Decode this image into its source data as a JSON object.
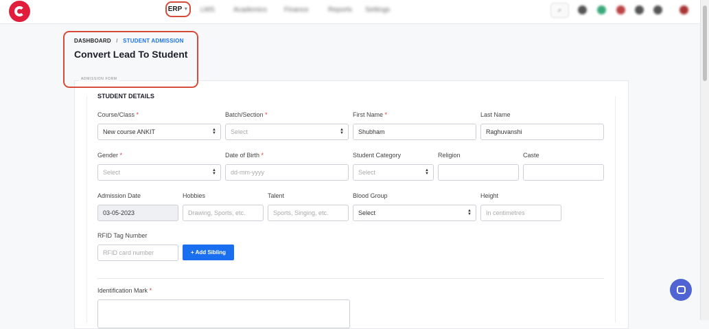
{
  "topbar": {
    "erp_label": "ERP",
    "nav_items": [
      "LMS",
      "Academics",
      "Finance",
      "Reports",
      "Settings"
    ]
  },
  "breadcrumb": {
    "home": "DASHBOARD",
    "separator": "/",
    "current": "STUDENT ADMISSION"
  },
  "page_title": "Convert Lead To Student",
  "form": {
    "legend": "ADMISSION FORM",
    "section_title": "STUDENT DETAILS",
    "fields": {
      "course_label": "Course/Class",
      "course_value": "New course ANKIT",
      "batch_label": "Batch/Section",
      "batch_value": "Select",
      "first_name_label": "First Name",
      "first_name_value": "Shubham",
      "last_name_label": "Last Name",
      "last_name_value": "Raghuvanshi",
      "gender_label": "Gender",
      "gender_value": "Select",
      "dob_label": "Date of Birth",
      "dob_placeholder": "dd-mm-yyyy",
      "category_label": "Student Category",
      "category_value": "Select",
      "religion_label": "Religion",
      "caste_label": "Caste",
      "admission_date_label": "Admission Date",
      "admission_date_value": "03-05-2023",
      "hobbies_label": "Hobbies",
      "hobbies_placeholder": "Drawing, Sports, etc.",
      "talent_label": "Talent",
      "talent_placeholder": "Sports, Singing, etc.",
      "blood_group_label": "Blood Group",
      "blood_group_value": "Select",
      "height_label": "Height",
      "height_placeholder": "In centimetres",
      "rfid_label": "RFID Tag Number",
      "rfid_placeholder": "RFID card number",
      "identification_label": "Identification Mark"
    },
    "add_sibling_label": "+ Add Sibling",
    "required_mark": "*"
  },
  "colors": {
    "accent": "#1a6ef0",
    "highlight": "#d64a38",
    "brand": "#e01e3c",
    "chat": "#4f63d2"
  }
}
